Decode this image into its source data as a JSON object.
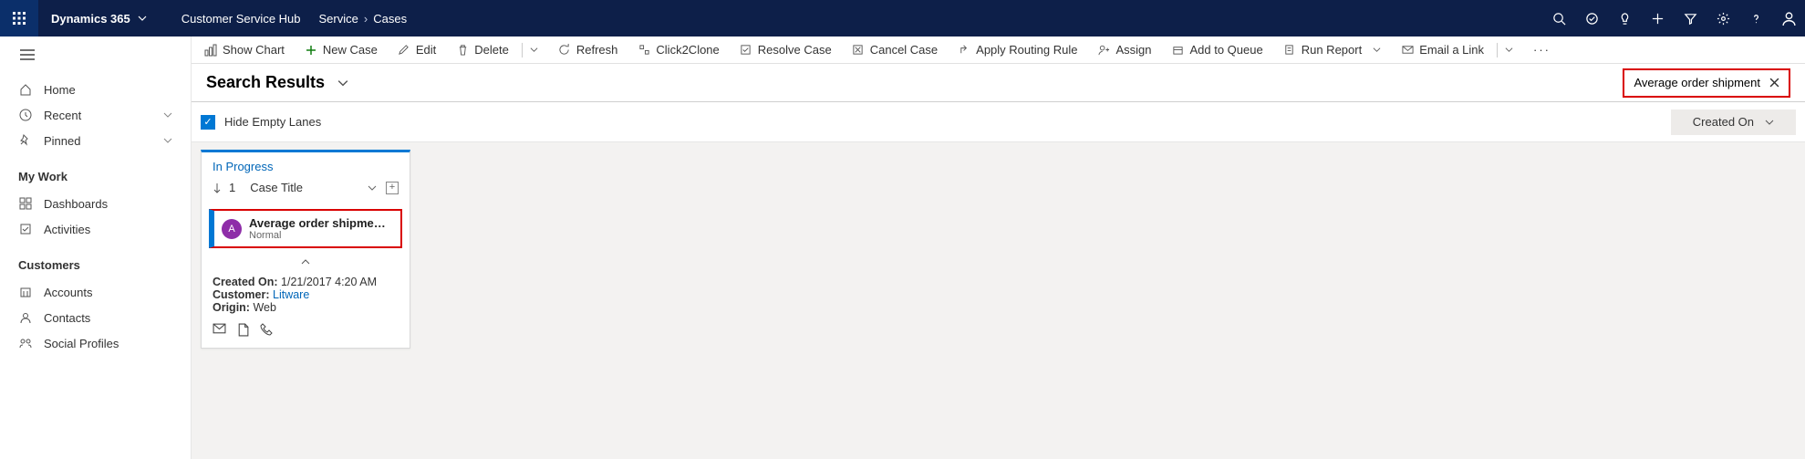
{
  "header": {
    "app": "Dynamics 365",
    "hub": "Customer Service Hub",
    "breadcrumb": [
      "Service",
      "Cases"
    ]
  },
  "commands": {
    "show_chart": "Show Chart",
    "new_case": "New Case",
    "edit": "Edit",
    "delete": "Delete",
    "refresh": "Refresh",
    "click2clone": "Click2Clone",
    "resolve_case": "Resolve Case",
    "cancel_case": "Cancel Case",
    "apply_routing": "Apply Routing Rule",
    "assign": "Assign",
    "add_to_queue": "Add to Queue",
    "run_report": "Run Report",
    "email_link": "Email a Link"
  },
  "sidebar": {
    "home": "Home",
    "recent": "Recent",
    "pinned": "Pinned",
    "group_mywork": "My Work",
    "dashboards": "Dashboards",
    "activities": "Activities",
    "group_customers": "Customers",
    "accounts": "Accounts",
    "contacts": "Contacts",
    "social": "Social Profiles"
  },
  "page": {
    "title": "Search Results",
    "search_term": "Average order shipment"
  },
  "subhead": {
    "hide_empty": "Hide Empty Lanes",
    "sort_btn": "Created On"
  },
  "lane": {
    "title": "In Progress",
    "rank": "1",
    "sort_field": "Case Title",
    "card": {
      "avatar": "A",
      "title": "Average order shipment ti...",
      "priority": "Normal"
    },
    "details": {
      "created_label": "Created On:",
      "created_val": "1/21/2017 4:20 AM",
      "customer_label": "Customer:",
      "customer_val": "Litware",
      "origin_label": "Origin:",
      "origin_val": "Web"
    }
  }
}
